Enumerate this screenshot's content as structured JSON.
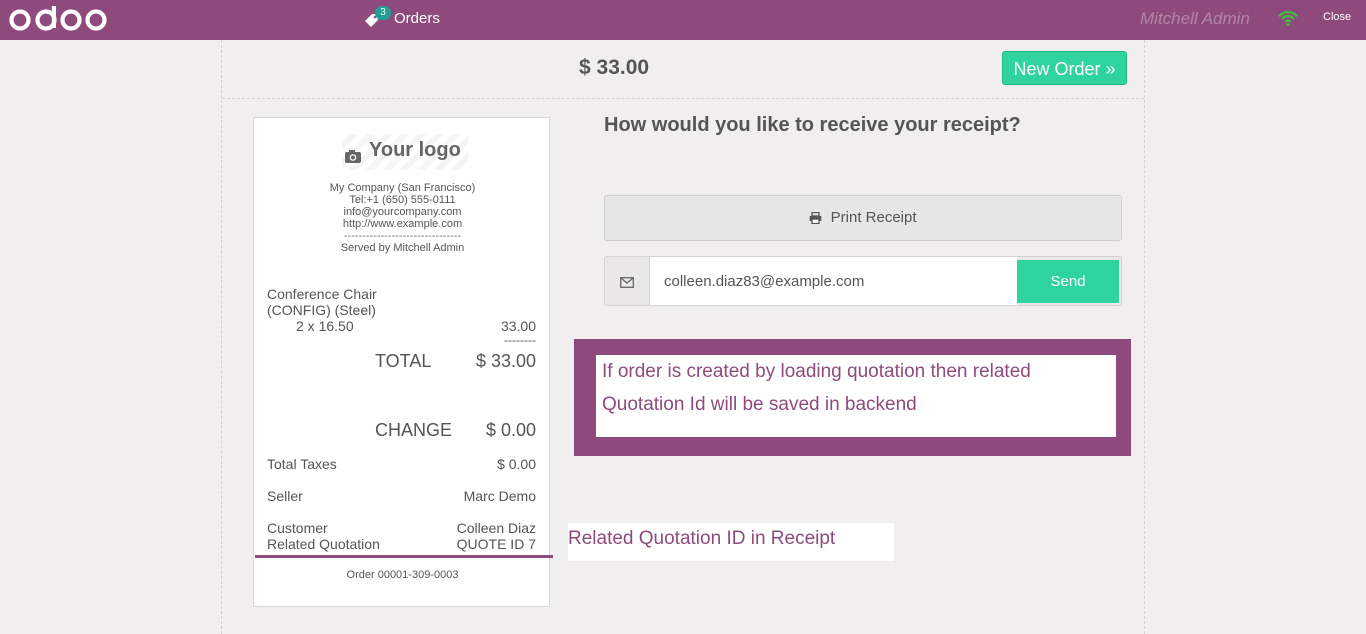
{
  "header": {
    "logo_text": "odoo",
    "orders_label": "Orders",
    "orders_count": "3",
    "user_name": "Mitchell Admin",
    "close_label": "Close",
    "brand_color": "#8f4a7d"
  },
  "screen": {
    "total": "$ 33.00",
    "new_order_label": "New Order »",
    "question": "How would you like to receive your receipt?",
    "print_label": "Print Receipt",
    "email_value": "colleen.diaz83@example.com",
    "send_label": "Send"
  },
  "receipt": {
    "logo_text": "Your logo",
    "company": "My Company (San Francisco)",
    "phone": "Tel:+1 (650) 555-0111",
    "email": "info@yourcompany.com",
    "website": "http://www.example.com",
    "separator": "--------------------------------",
    "served_by": "Served by Mitchell Admin",
    "product_line1": "Conference Chair",
    "product_line2": "(CONFIG) (Steel)",
    "qty_price": "2 x 16.50",
    "line_total": "33.00",
    "dashes": "--------",
    "total_label": "TOTAL",
    "total_value": "$ 33.00",
    "change_label": "CHANGE",
    "change_value": "$ 0.00",
    "taxes_label": "Total Taxes",
    "taxes_value": "$ 0.00",
    "seller_label": "Seller",
    "seller_value": "Marc Demo",
    "customer_label": "Customer",
    "customer_value": "Colleen Diaz",
    "quotation_label": "Related Quotation",
    "quotation_value": "QUOTE ID 7",
    "order_ref": "Order 00001-309-0003"
  },
  "annotations": {
    "note": "If order is created by loading quotation then related Quotation Id will be saved in backend",
    "label": "Related Quotation ID in Receipt"
  },
  "icons": [
    "tag-icon",
    "wifi-icon",
    "camera-icon",
    "printer-icon",
    "envelope-icon"
  ]
}
